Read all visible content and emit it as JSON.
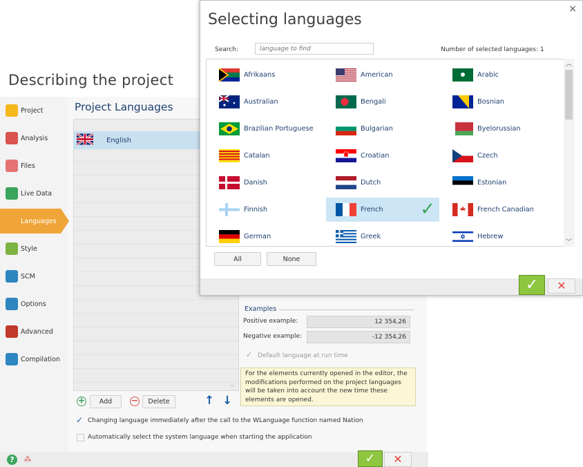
{
  "background_window": {
    "title": "Describing the project",
    "sidebar": {
      "items": [
        {
          "label": "Project",
          "icon": "project-icon",
          "color": "#f5b81b"
        },
        {
          "label": "Analysis",
          "icon": "analysis-icon",
          "color": "#d9534f"
        },
        {
          "label": "Files",
          "icon": "files-icon",
          "color": "#e57373"
        },
        {
          "label": "Live Data",
          "icon": "live-data-icon",
          "color": "#3ba55c"
        },
        {
          "label": "Languages",
          "icon": "languages-icon",
          "color": "#f0a538"
        },
        {
          "label": "Style",
          "icon": "style-icon",
          "color": "#7cb342"
        },
        {
          "label": "SCM",
          "icon": "scm-icon",
          "color": "#2e86c1"
        },
        {
          "label": "Options",
          "icon": "options-icon",
          "color": "#2e86c1"
        },
        {
          "label": "Advanced",
          "icon": "advanced-icon",
          "color": "#c0392b"
        },
        {
          "label": "Compilation",
          "icon": "compilation-icon",
          "color": "#2e86c1"
        }
      ],
      "active": "Languages"
    },
    "panel_title": "Project Languages",
    "languages": [
      "English"
    ],
    "add_label": "Add",
    "delete_label": "Delete",
    "format": {
      "legend": "Examples",
      "positive_label": "Positive example:",
      "positive_value": "12 354,26",
      "negative_label": "Negative example:",
      "negative_value": "-12 354,26"
    },
    "default_language_label": "Default language at run time",
    "note": "For the elements currently opened in the editor, the modifications performed on the project languages will be taken into account the new time these elements are opened.",
    "option_nation": "Changing language immediately after the call to the WLanguage function named Nation",
    "option_auto": "Automatically select the system language when starting the application"
  },
  "dialog": {
    "title": "Selecting languages",
    "close": "×",
    "search_label": "Search:",
    "search_placeholder": "language to find",
    "count_label": "Number of selected languages:",
    "count_value": "1",
    "languages": [
      {
        "name": "Afrikaans",
        "flag": "za",
        "selected": false
      },
      {
        "name": "American",
        "flag": "us",
        "selected": false
      },
      {
        "name": "Arabic",
        "flag": "sa",
        "selected": false
      },
      {
        "name": "Australian",
        "flag": "au",
        "selected": false
      },
      {
        "name": "Bengali",
        "flag": "bd",
        "selected": false
      },
      {
        "name": "Bosnian",
        "flag": "ba",
        "selected": false
      },
      {
        "name": "Brazilian Portuguese",
        "flag": "br",
        "selected": false
      },
      {
        "name": "Bulgarian",
        "flag": "bg",
        "selected": false
      },
      {
        "name": "Byelorussian",
        "flag": "by",
        "selected": false
      },
      {
        "name": "Catalan",
        "flag": "ct",
        "selected": false
      },
      {
        "name": "Croatian",
        "flag": "hr",
        "selected": false
      },
      {
        "name": "Czech",
        "flag": "cz",
        "selected": false
      },
      {
        "name": "Danish",
        "flag": "dk",
        "selected": false
      },
      {
        "name": "Dutch",
        "flag": "nl",
        "selected": false
      },
      {
        "name": "Estonian",
        "flag": "ee",
        "selected": false
      },
      {
        "name": "Finnish",
        "flag": "fi",
        "selected": false
      },
      {
        "name": "French",
        "flag": "fr",
        "selected": true
      },
      {
        "name": "French Canadian",
        "flag": "ca",
        "selected": false
      },
      {
        "name": "German",
        "flag": "de",
        "selected": false
      },
      {
        "name": "Greek",
        "flag": "gr",
        "selected": false
      },
      {
        "name": "Hebrew",
        "flag": "il",
        "selected": false
      }
    ],
    "all_label": "All",
    "none_label": "None"
  },
  "colors": {
    "accent_orange": "#f0a538",
    "ok_green": "#8ec63f",
    "selection_blue": "#cde6f5",
    "language_text": "#1f3f70",
    "cancel_red": "#e0463c"
  }
}
